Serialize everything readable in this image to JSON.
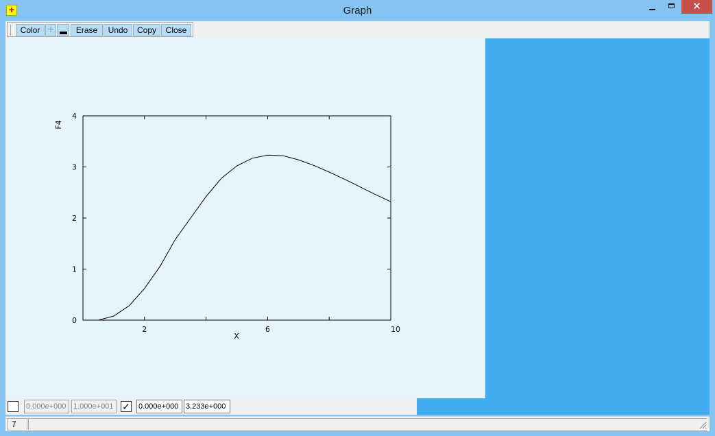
{
  "window": {
    "title": "Graph",
    "icon_glyph": "+",
    "close_glyph": "✕"
  },
  "toolbar": {
    "color_label": "Color",
    "plus_glyph": "+",
    "erase_label": "Erase",
    "undo_label": "Undo",
    "copy_label": "Copy",
    "close_label": "Close"
  },
  "chart_data": {
    "type": "line",
    "title": "",
    "xlabel": "X",
    "ylabel": "F4",
    "xlim": [
      0,
      10
    ],
    "ylim": [
      0,
      4
    ],
    "x_ticks": [
      2,
      6,
      10
    ],
    "x_minor": [
      4,
      8
    ],
    "y_ticks": [
      0,
      1,
      2,
      3,
      4
    ],
    "x_tick_labels": [
      "2",
      "6",
      "10"
    ],
    "y_tick_labels": [
      "0",
      "1",
      "2",
      "3",
      "4"
    ],
    "series": [
      {
        "x": [
          0.5,
          1.0,
          1.5,
          2.0,
          2.5,
          3.0,
          3.5,
          4.0,
          4.5,
          5.0,
          5.5,
          6.0,
          6.5,
          7.0,
          7.5,
          8.0,
          8.5,
          9.0,
          9.5,
          10.0
        ],
        "y": [
          0.0,
          0.08,
          0.28,
          0.62,
          1.05,
          1.58,
          2.0,
          2.42,
          2.78,
          3.02,
          3.17,
          3.23,
          3.22,
          3.14,
          3.03,
          2.9,
          2.76,
          2.61,
          2.46,
          2.32
        ]
      }
    ],
    "grid": false,
    "color": "#000000"
  },
  "range": {
    "x_min": "0.000e+000",
    "x_max": "1.000e+001",
    "y_min": "0.000e+000",
    "y_max": "3.233e+000",
    "x_auto_check": "",
    "y_auto_check": "✓"
  },
  "status": {
    "value": "7"
  }
}
